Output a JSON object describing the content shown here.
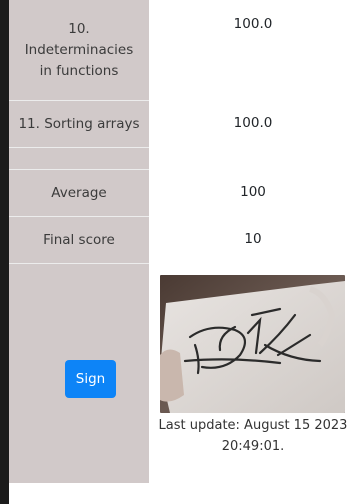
{
  "rows": [
    {
      "label": "10. Indeterminacies in functions",
      "value": "100.0"
    },
    {
      "label": "11. Sorting arrays",
      "value": "100.0"
    },
    {
      "label": "",
      "value": ""
    },
    {
      "label": "Average",
      "value": "100"
    },
    {
      "label": "Final score",
      "value": "10"
    }
  ],
  "sign_button_label": "Sign",
  "signature": {
    "last_update": "Last update: August 15 2023 20:49:01."
  }
}
